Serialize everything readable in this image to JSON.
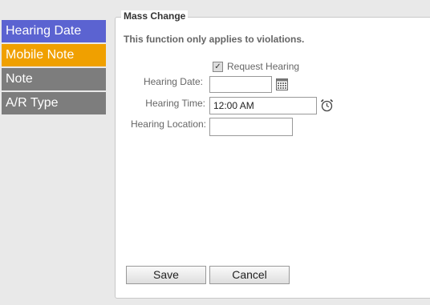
{
  "sidebar": {
    "items": [
      {
        "label": "Hearing Date",
        "color": "#5b63d1"
      },
      {
        "label": "Mobile Note",
        "color": "#f0a000"
      },
      {
        "label": "Note",
        "color": "#7d7d7d"
      },
      {
        "label": "A/R Type",
        "color": "#7d7d7d"
      }
    ]
  },
  "panel": {
    "legend": "Mass Change",
    "note": "This function only applies to violations.",
    "request_hearing_label": "Request Hearing",
    "request_hearing_checked": true,
    "hearing_date_label": "Hearing Date:",
    "hearing_date_value": "",
    "hearing_time_label": "Hearing Time:",
    "hearing_time_value": "12:00 AM",
    "hearing_location_label": "Hearing Location:",
    "hearing_location_value": "",
    "save_label": "Save",
    "cancel_label": "Cancel"
  },
  "icons": {
    "calendar": "calendar-icon",
    "clock": "alarm-clock-icon"
  }
}
